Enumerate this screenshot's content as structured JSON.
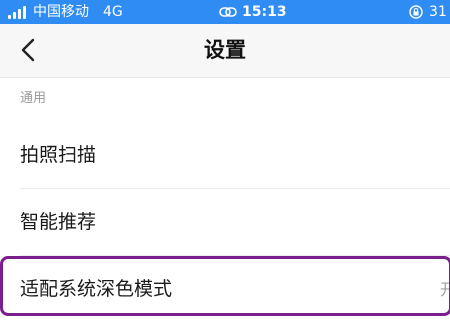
{
  "status_bar": {
    "carrier": "中国移动",
    "network": "4G",
    "time": "15:13",
    "battery": "31",
    "icons": [
      "signal-bars-icon",
      "link-icon",
      "orientation-lock-icon"
    ]
  },
  "nav": {
    "title": "设置",
    "back_icon": "chevron-left-icon"
  },
  "section": {
    "header": "通用",
    "items": [
      {
        "label": "拍照扫描"
      },
      {
        "label": "智能推荐"
      },
      {
        "label": "适配系统深色模式",
        "value": "开"
      }
    ]
  },
  "colors": {
    "status_bar_bg": "#2f8cf2",
    "highlight_border": "#7b1f8c"
  }
}
